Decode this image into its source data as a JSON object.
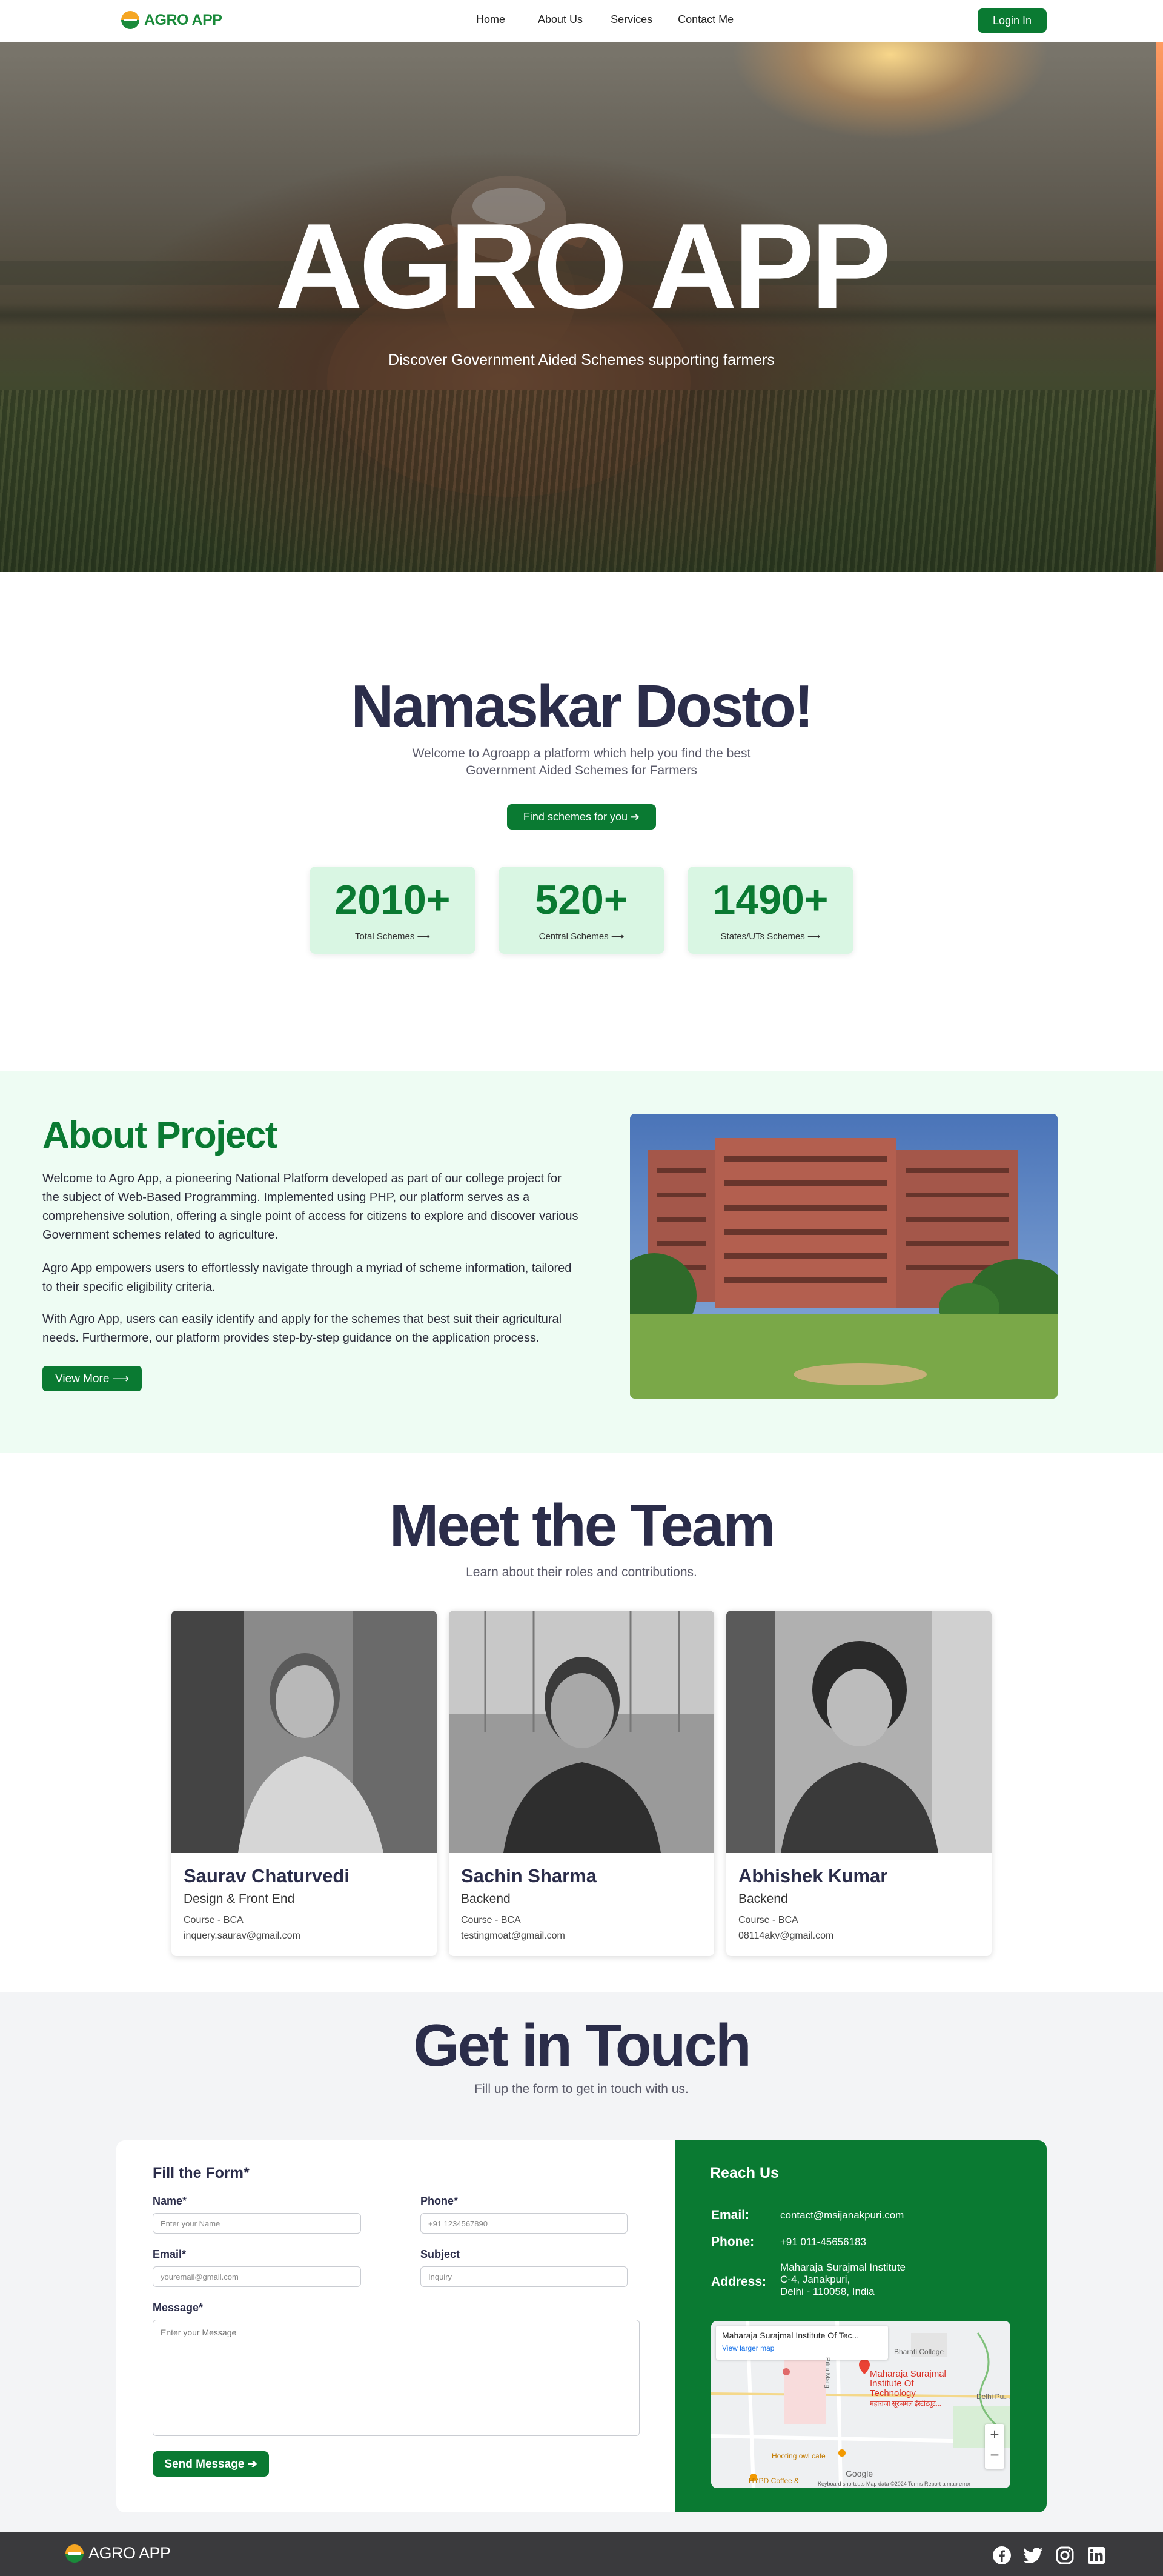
{
  "nav": {
    "brand": "AGRO APP",
    "links": [
      "Home",
      "About Us",
      "Services",
      "Contact Me"
    ],
    "login": "Login In"
  },
  "hero": {
    "title": "AGRO APP",
    "subtitle": "Discover Government Aided Schemes supporting farmers"
  },
  "welcome": {
    "title": "Namaskar Dosto!",
    "subtitle": "Welcome to Agroapp a platform which help you find the best Government Aided Schemes for Farmers",
    "cta": "Find schemes for you ➔",
    "stats": [
      {
        "value": "2010+",
        "label": "Total Schemes ⟶"
      },
      {
        "value": "520+",
        "label": "Central Schemes ⟶"
      },
      {
        "value": "1490+",
        "label": "States/UTs Schemes ⟶"
      }
    ]
  },
  "about": {
    "title": "About Project",
    "p1": "Welcome to Agro App, a pioneering National Platform developed as part of our college project for the subject of Web-Based Programming. Implemented using PHP, our platform serves as a comprehensive solution, offering a single point of access for citizens to explore and discover various Government schemes related to agriculture.",
    "p2": "Agro App empowers users to effortlessly navigate through a myriad of scheme information, tailored to their specific eligibility criteria.",
    "p3": "With Agro App, users can easily identify and apply for the schemes that best suit their agricultural needs. Furthermore, our platform provides step-by-step guidance on the application process.",
    "cta": "View More ⟶"
  },
  "team": {
    "title": "Meet the Team",
    "subtitle": "Learn about their roles and contributions.",
    "members": [
      {
        "name": "Saurav Chaturvedi",
        "role": "Design & Front End",
        "course": "Course - BCA",
        "email": "inquery.saurav@gmail.com"
      },
      {
        "name": "Sachin Sharma",
        "role": "Backend",
        "course": "Course - BCA",
        "email": "testingmoat@gmail.com"
      },
      {
        "name": "Abhishek Kumar",
        "role": "Backend",
        "course": "Course - BCA",
        "email": "08114akv@gmail.com"
      }
    ]
  },
  "contact": {
    "title": "Get in Touch",
    "subtitle": "Fill up the form to get in touch with us.",
    "form": {
      "title": "Fill the Form*",
      "name_label": "Name*",
      "name_placeholder": "Enter your Name",
      "phone_label": "Phone*",
      "phone_placeholder": "+91 1234567890",
      "email_label": "Email*",
      "email_placeholder": "youremail@gmail.com",
      "subject_label": "Subject",
      "subject_placeholder": "Inquiry",
      "message_label": "Message*",
      "message_placeholder": "Enter your Message",
      "send": "Send Message ➔"
    },
    "reach": {
      "title": "Reach Us",
      "email_label": "Email:",
      "email": "contact@msijanakpuri.com",
      "phone_label": "Phone:",
      "phone": "+91 011-45656183",
      "address_label": "Address:",
      "address_line1": "Maharaja Surajmal Institute",
      "address_line2": "C-4, Janakpuri,",
      "address_line3": "Delhi - 110058, India"
    },
    "map": {
      "card_title": "Maharaja Surajmal Institute Of Tec...",
      "card_link": "View larger map",
      "pin_label": "Maharaja Surajmal Institute Of Technology",
      "pin_sub": "महाराजा सूरजमल इंस्टीट्यूट...",
      "place1": "Bharati College",
      "place2": "Delhi Pu...",
      "place3": "Hooting owl cafe",
      "place4": "HYPD Coffee &",
      "road": "Pitru Marg",
      "brand": "Google",
      "footer": "Keyboard shortcuts   Map data ©2024   Terms   Report a map error",
      "zoom_in": "+",
      "zoom_out": "−"
    }
  },
  "footer": {
    "brand": "AGRO APP",
    "socials": [
      "facebook-icon",
      "twitter-icon",
      "instagram-icon",
      "linkedin-icon"
    ]
  }
}
